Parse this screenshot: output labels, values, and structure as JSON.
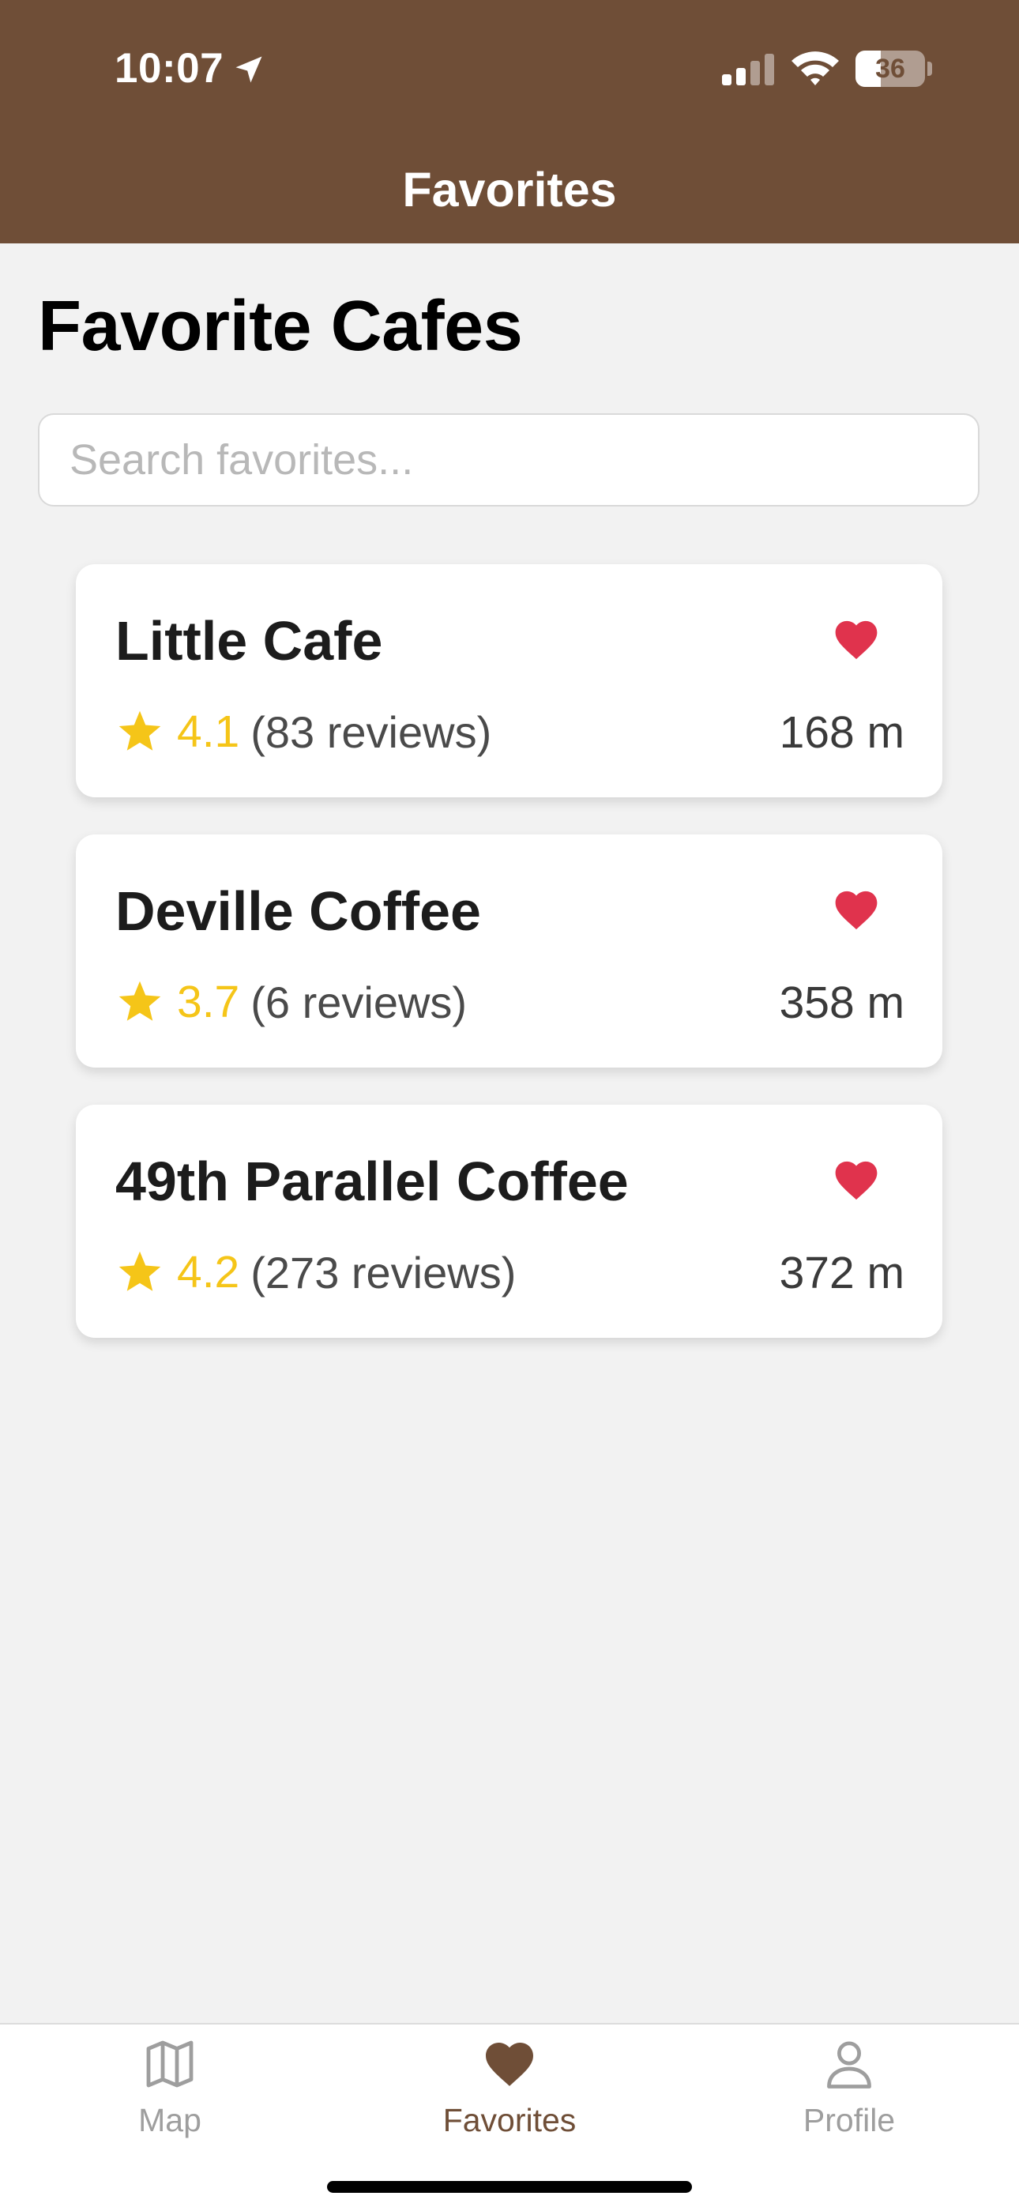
{
  "status_bar": {
    "time": "10:07",
    "battery_level": "36",
    "battery_fraction": 0.36
  },
  "nav": {
    "title": "Favorites"
  },
  "colors": {
    "header_bg": "#6f4e37",
    "accent_brown": "#6f4e37",
    "heart_red": "#e0334d",
    "star_gold": "#f5c518",
    "inactive_gray": "#9e9e9e"
  },
  "main": {
    "title": "Favorite Cafes",
    "search": {
      "placeholder": "Search favorites...",
      "value": ""
    },
    "cafes": [
      {
        "name": "Little Cafe",
        "rating": "4.1",
        "reviews": "(83 reviews)",
        "distance": "168 m",
        "favorited": true
      },
      {
        "name": "Deville Coffee",
        "rating": "3.7",
        "reviews": "(6 reviews)",
        "distance": "358 m",
        "favorited": true
      },
      {
        "name": "49th Parallel Coffee",
        "rating": "4.2",
        "reviews": "(273 reviews)",
        "distance": "372 m",
        "favorited": true
      }
    ]
  },
  "tab_bar": {
    "tabs": [
      {
        "label": "Map",
        "icon": "map-icon",
        "active": false
      },
      {
        "label": "Favorites",
        "icon": "heart-icon",
        "active": true
      },
      {
        "label": "Profile",
        "icon": "person-icon",
        "active": false
      }
    ]
  }
}
